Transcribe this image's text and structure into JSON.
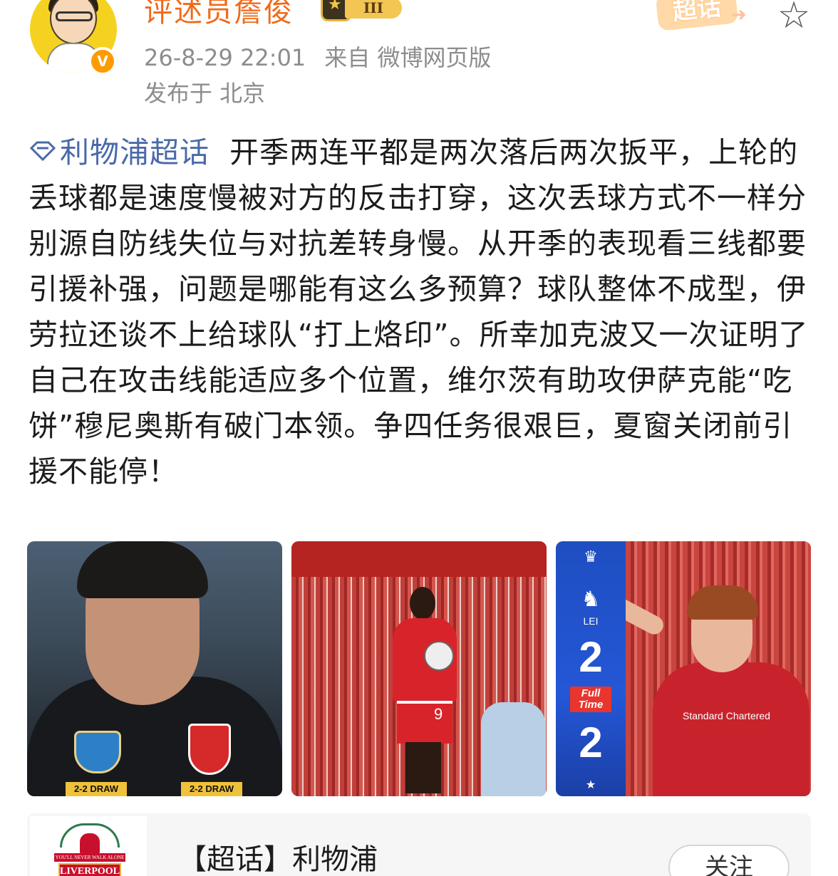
{
  "header": {
    "username": "评述员詹俊",
    "level_badge": "III",
    "verified_mark": "V",
    "sticker_text": "超话",
    "post_time": "26-8-29 22:01",
    "source": "来自 微博网页版",
    "location": "发布于 北京"
  },
  "post": {
    "topic_link": "利物浦超话",
    "body": "开季两连平都是两次落后两次扳平，上轮的丢球都是速度慢被对方的反击打穿，这次丢球方式不一样分别源自防线失位与对抗差转身慢。从开季的表现看三线都要引援补强，问题是哪能有这么多预算？球队整体不成型，伊劳拉还谈不上给球队“打上烙印”。所幸加克波又一次证明了自己在攻击线能适应多个位置，维尔茨有助攻伊萨克能“吃饼”穆尼奥斯有破门本领。争四任务很艰巨，夏窗关闭前引援不能停！"
  },
  "images": {
    "img1": {
      "draw_left": "2-2 DRAW",
      "draw_right": "2-2 DRAW"
    },
    "img2": {
      "shirt_number": "9"
    },
    "img3": {
      "team_abbr": "LEI",
      "score_home": "2",
      "status": "Full Time",
      "score_away": "2",
      "sponsor": "Standard Chartered"
    }
  },
  "supertopic_card": {
    "logo_motto": "YOU'LL NEVER WALK ALONE",
    "logo_name": "LIVERPOOL",
    "title": "【超话】利物浦",
    "follow_label": "关注"
  },
  "colors": {
    "username": "#f06a1a",
    "meta": "#8d8d8d",
    "topic_link": "#4a6aa8",
    "score_strip": "#2457d6"
  }
}
